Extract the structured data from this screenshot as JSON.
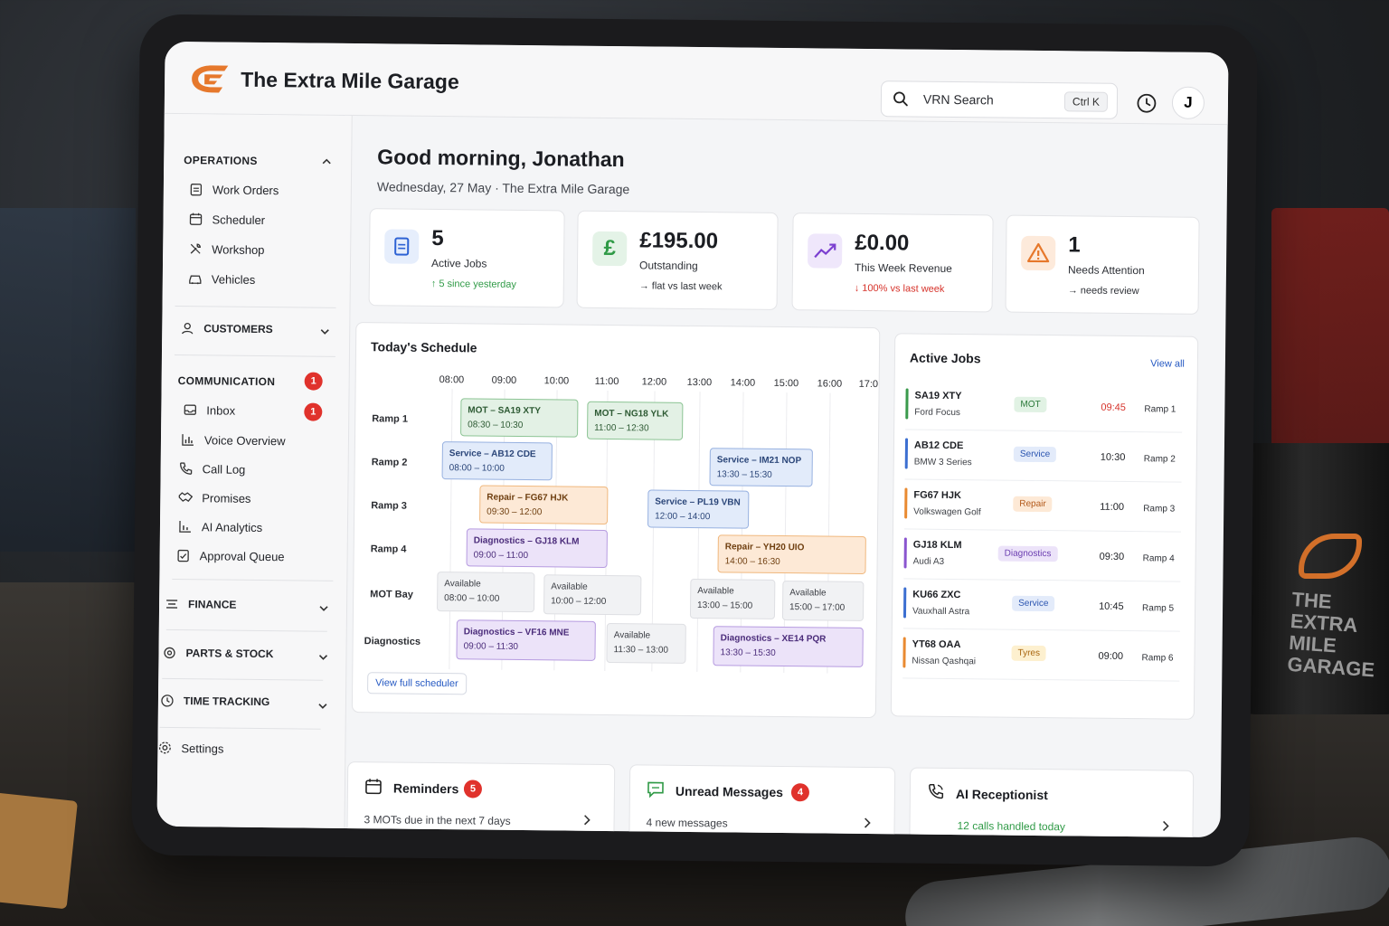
{
  "header": {
    "brand": "The Extra Mile Garage",
    "search_placeholder": "VRN Search",
    "search_shortcut": "Ctrl K",
    "avatar_initial": "J"
  },
  "sidebar": {
    "operations": {
      "title": "OPERATIONS",
      "items": [
        "Work Orders",
        "Scheduler",
        "Workshop",
        "Vehicles"
      ]
    },
    "customers": "CUSTOMERS",
    "communication": {
      "title": "COMMUNICATION",
      "badge": "1",
      "items": [
        "Inbox",
        "Voice Overview",
        "Call Log",
        "Promises",
        "AI Analytics",
        "Approval Queue"
      ],
      "inbox_badge": "1"
    },
    "finance": "FINANCE",
    "parts": "PARTS & STOCK",
    "time": "TIME TRACKING",
    "settings": "Settings"
  },
  "greeting": {
    "title": "Good morning, Jonathan",
    "subtitle": "Wednesday, 27 May · The Extra Mile Garage"
  },
  "stats": [
    {
      "value": "5",
      "label": "Active Jobs",
      "sub": "↑ 5 since yesterday",
      "sub_color": "#2f9a46"
    },
    {
      "value": "£195.00",
      "label": "Outstanding",
      "sub": "→ flat vs last week",
      "sub_color": "#2c2f35"
    },
    {
      "value": "£0.00",
      "label": "This Week Revenue",
      "sub": "↓ 100% vs last week",
      "sub_color": "#d6322a"
    },
    {
      "value": "1",
      "label": "Needs Attention",
      "sub": "→ needs review",
      "sub_color": "#2c2f35"
    }
  ],
  "schedule": {
    "title": "Today's Schedule",
    "times": [
      "08:00",
      "09:00",
      "10:00",
      "11:00",
      "12:00",
      "13:00",
      "14:00",
      "15:00",
      "16:00",
      "17:0"
    ],
    "ramps": [
      "Ramp 1",
      "Ramp 2",
      "Ramp 3",
      "Ramp 4",
      "MOT Bay",
      "Diagnostics"
    ],
    "blocks": [
      {
        "title": "MOT – SA19 XTY",
        "time": "08:30 – 10:30"
      },
      {
        "title": "MOT – NG18 YLK",
        "time": "11:00 – 12:30"
      },
      {
        "title": "Service – AB12 CDE",
        "time": "08:00 – 10:00"
      },
      {
        "title": "Service – IM21 NOP",
        "time": "13:30 – 15:30"
      },
      {
        "title": "Repair – FG67 HJK",
        "time": "09:30 – 12:00"
      },
      {
        "title": "Service – PL19 VBN",
        "time": "12:00 – 14:00"
      },
      {
        "title": "Diagnostics – GJ18 KLM",
        "time": "09:00 – 11:00"
      },
      {
        "title": "Repair – YH20 UIO",
        "time": "14:00 – 16:30"
      },
      {
        "title": "Available",
        "time": "08:00 – 10:00"
      },
      {
        "title": "Available",
        "time": "10:00 – 12:00"
      },
      {
        "title": "Available",
        "time": "13:00 – 15:00"
      },
      {
        "title": "Available",
        "time": "15:00 – 17:00"
      },
      {
        "title": "Diagnostics – VF16 MNE",
        "time": "09:00 – 11:30"
      },
      {
        "title": "Available",
        "time": "11:30 – 13:00"
      },
      {
        "title": "Diagnostics – XE14 PQR",
        "time": "13:30 – 15:30"
      }
    ],
    "button": "View full scheduler"
  },
  "active_jobs": {
    "title": "Active Jobs",
    "view_all": "View all",
    "jobs": [
      {
        "reg": "SA19 XTY",
        "car": "Ford Focus",
        "tag": "MOT",
        "time": "09:45",
        "ramp": "Ramp 1",
        "color": "#3a9a4c"
      },
      {
        "reg": "AB12 CDE",
        "car": "BMW 3 Series",
        "tag": "Service",
        "time": "10:30",
        "ramp": "Ramp 2",
        "color": "#3c6fd1"
      },
      {
        "reg": "FG67 HJK",
        "car": "Volkswagen Golf",
        "tag": "Repair",
        "time": "11:00",
        "ramp": "Ramp 3",
        "color": "#e98a31"
      },
      {
        "reg": "GJ18 KLM",
        "car": "Audi A3",
        "tag": "Diagnostics",
        "time": "09:30",
        "ramp": "Ramp 4",
        "color": "#8a55cf"
      },
      {
        "reg": "KU66 ZXC",
        "car": "Vauxhall Astra",
        "tag": "Service",
        "time": "10:45",
        "ramp": "Ramp 5",
        "color": "#3c6fd1"
      },
      {
        "reg": "YT68 OAA",
        "car": "Nissan Qashqai",
        "tag": "Tyres",
        "time": "09:00",
        "ramp": "Ramp 6",
        "color": "#e98a31"
      }
    ]
  },
  "bottom": {
    "reminders": {
      "title": "Reminders",
      "badge": "5",
      "sub": "3 MOTs due in the next 7 days"
    },
    "messages": {
      "title": "Unread Messages",
      "badge": "4",
      "sub": "4 new messages"
    },
    "receptionist": {
      "title": "AI Receptionist",
      "sub": "12 calls handled today"
    }
  },
  "mug_text": "THE EXTRA MILE GARAGE",
  "colors": {
    "accent": "#e6782c",
    "link": "#2458c2",
    "badge": "#e0322c"
  }
}
